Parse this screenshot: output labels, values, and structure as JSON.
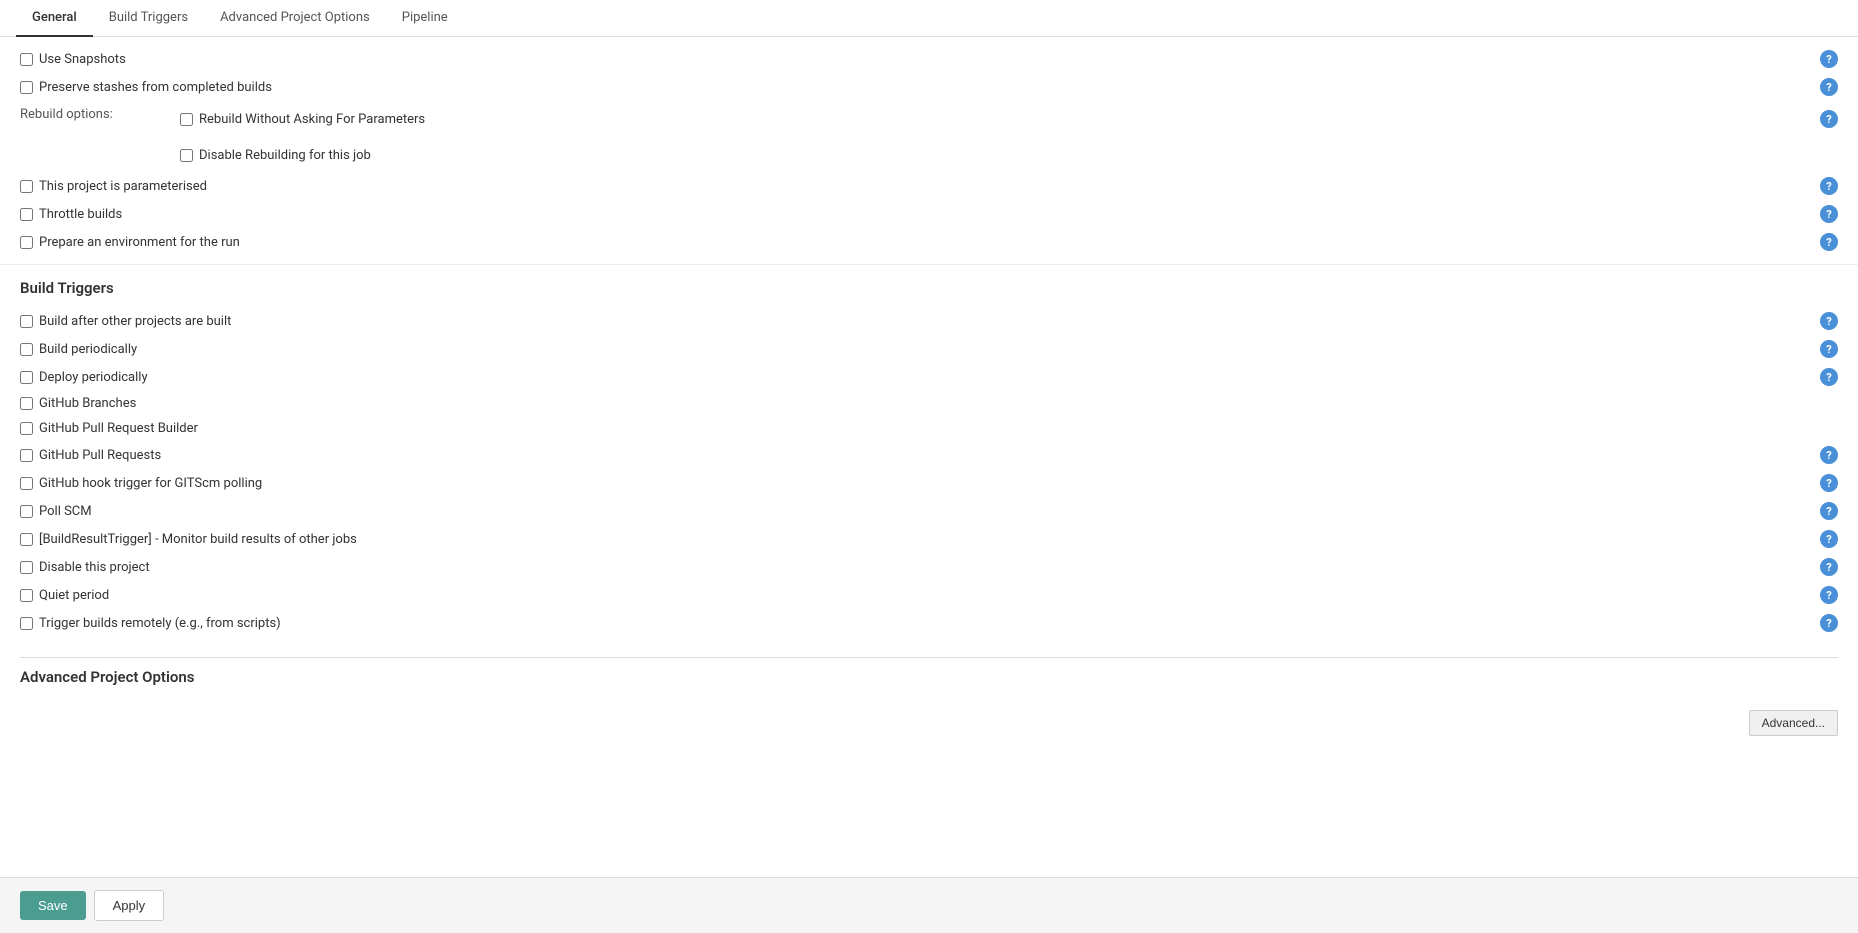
{
  "tabs": [
    {
      "id": "general",
      "label": "General",
      "active": true
    },
    {
      "id": "build-triggers",
      "label": "Build Triggers",
      "active": false
    },
    {
      "id": "advanced-project-options",
      "label": "Advanced Project Options",
      "active": false
    },
    {
      "id": "pipeline",
      "label": "Pipeline",
      "active": false
    }
  ],
  "general": {
    "checkboxes": [
      {
        "id": "use-snapshots",
        "label": "Use Snapshots",
        "checked": false
      },
      {
        "id": "preserve-stashes",
        "label": "Preserve stashes from completed builds",
        "checked": false
      }
    ],
    "rebuild_options": {
      "label": "Rebuild options:",
      "options": [
        {
          "id": "rebuild-without-asking",
          "label": "Rebuild Without Asking For Parameters",
          "checked": false
        },
        {
          "id": "disable-rebuilding",
          "label": "Disable Rebuilding for this job",
          "checked": false
        }
      ]
    },
    "more_checkboxes": [
      {
        "id": "this-project-parameterised",
        "label": "This project is parameterised",
        "checked": false
      },
      {
        "id": "throttle-builds",
        "label": "Throttle builds",
        "checked": false
      },
      {
        "id": "prepare-environment",
        "label": "Prepare an environment for the run",
        "checked": false
      }
    ]
  },
  "build_triggers": {
    "title": "Build Triggers",
    "checkboxes": [
      {
        "id": "build-after-other",
        "label": "Build after other projects are built",
        "checked": false
      },
      {
        "id": "build-periodically",
        "label": "Build periodically",
        "checked": false
      },
      {
        "id": "deploy-periodically",
        "label": "Deploy periodically",
        "checked": false
      },
      {
        "id": "github-branches",
        "label": "GitHub Branches",
        "checked": false
      },
      {
        "id": "github-pull-request-builder",
        "label": "GitHub Pull Request Builder",
        "checked": false
      },
      {
        "id": "github-pull-requests",
        "label": "GitHub Pull Requests",
        "checked": false
      },
      {
        "id": "github-hook-trigger",
        "label": "GitHub hook trigger for GITScm polling",
        "checked": false
      },
      {
        "id": "poll-scm",
        "label": "Poll SCM",
        "checked": false
      },
      {
        "id": "build-result-trigger",
        "label": "[BuildResultTrigger] - Monitor build results of other jobs",
        "checked": false
      },
      {
        "id": "disable-project",
        "label": "Disable this project",
        "checked": false
      },
      {
        "id": "quiet-period",
        "label": "Quiet period",
        "checked": false
      },
      {
        "id": "trigger-builds-remotely",
        "label": "Trigger builds remotely (e.g., from scripts)",
        "checked": false
      }
    ]
  },
  "advanced_project_options": {
    "title": "Advanced Project Options",
    "advanced_button_label": "Advanced..."
  },
  "footer": {
    "save_label": "Save",
    "apply_label": "Apply"
  }
}
